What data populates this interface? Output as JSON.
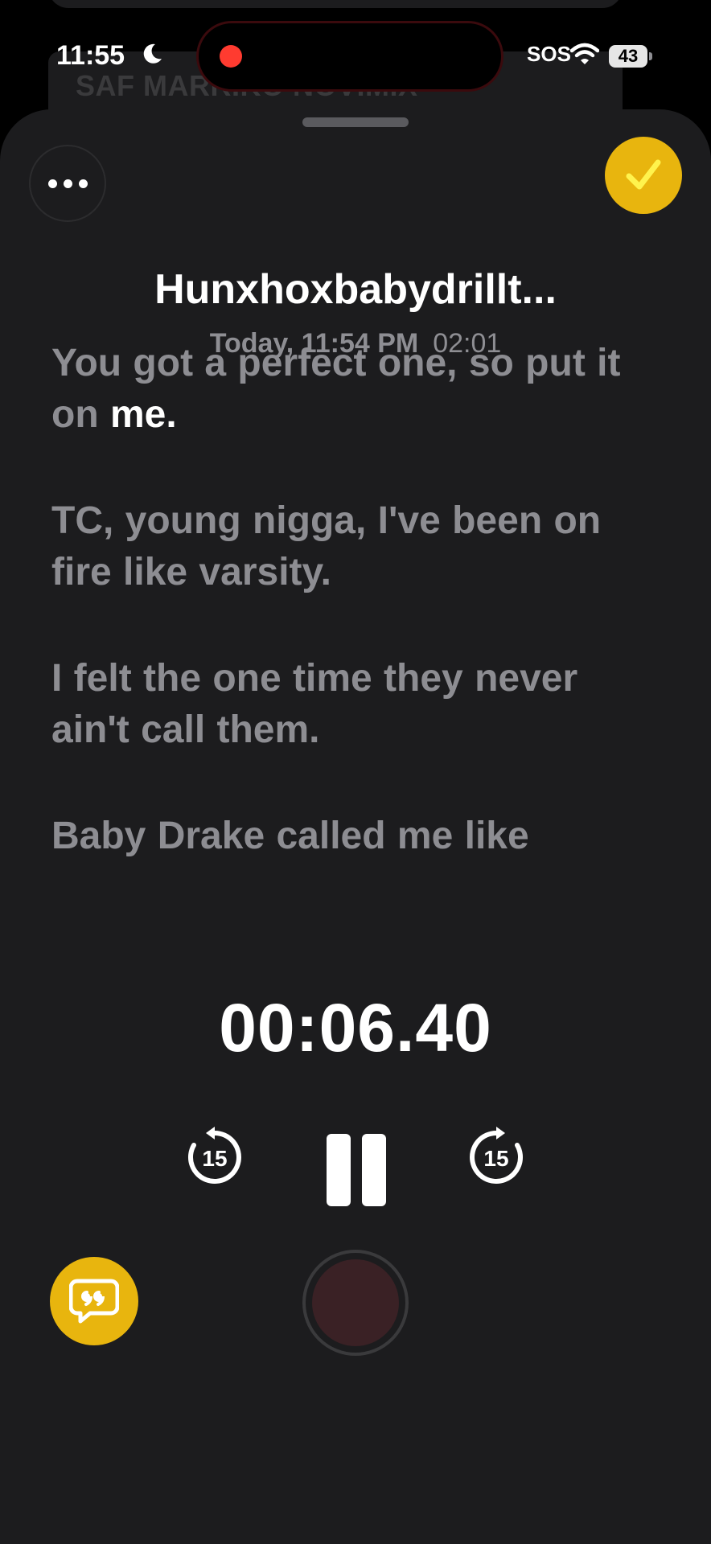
{
  "status_bar": {
    "time": "11:55",
    "sos": "SOS",
    "battery": "43",
    "icons": [
      "moon-icon",
      "wifi-icon",
      "battery-icon"
    ]
  },
  "background": {
    "card_text": "SAF MARRIKO NOVIMIX"
  },
  "recording": {
    "title": "Hunxhoxbabydrillt...",
    "date": "Today, 11:54 PM",
    "duration": "02:01"
  },
  "transcript": {
    "lines": [
      {
        "text": "You got a perfect one, so put it on ",
        "highlight": "me."
      },
      {
        "text": "TC, young nigga, I've been on fire like varsity.",
        "highlight": ""
      },
      {
        "text": "I felt the one time they never ain't call them.",
        "highlight": ""
      },
      {
        "text": "Baby Drake called me like",
        "highlight": ""
      }
    ]
  },
  "player": {
    "elapsed": "00:06.40",
    "skip_back_seconds": "15",
    "skip_forward_seconds": "15"
  },
  "colors": {
    "accent": "#e8b50e",
    "sheet": "#1c1c1e",
    "recording_dot": "#ff3b30",
    "secondary_text": "#8e8e93"
  }
}
